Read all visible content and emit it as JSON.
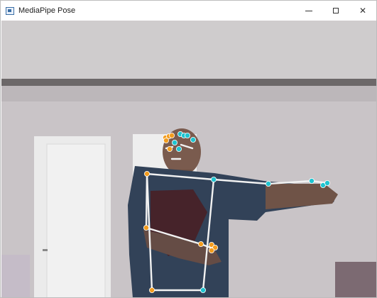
{
  "window": {
    "title": "MediaPipe Pose",
    "controls": {
      "minimize_icon": "minimize-icon",
      "maximize_icon": "maximize-icon",
      "close_icon": "close-icon",
      "close_glyph": "✕"
    }
  },
  "overlay": {
    "line_color": "#f2f2f2",
    "left_landmark_color": "#f39c1e",
    "right_landmark_color": "#1fc4d0"
  }
}
